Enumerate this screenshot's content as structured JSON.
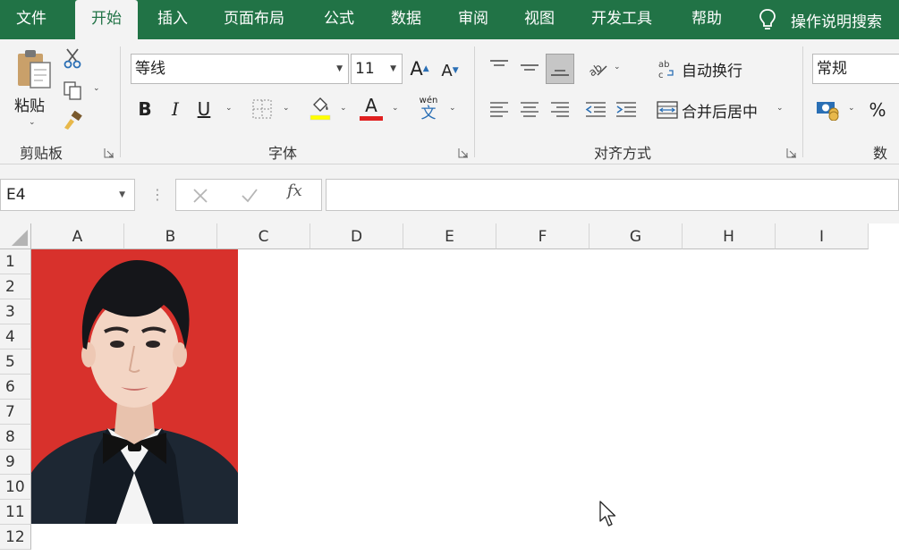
{
  "tabs": [
    {
      "label": "文件"
    },
    {
      "label": "开始"
    },
    {
      "label": "插入"
    },
    {
      "label": "页面布局"
    },
    {
      "label": "公式"
    },
    {
      "label": "数据"
    },
    {
      "label": "审阅"
    },
    {
      "label": "视图"
    },
    {
      "label": "开发工具"
    },
    {
      "label": "帮助"
    }
  ],
  "tell_me": "操作说明搜索",
  "ribbon": {
    "clipboard": {
      "paste_label": "粘贴",
      "group_label": "剪贴板"
    },
    "font": {
      "font_name": "等线",
      "font_size": "11",
      "grow_label": "A",
      "shrink_label": "A",
      "bold_label": "B",
      "italic_label": "I",
      "underline_label": "U",
      "font_color_label": "A",
      "phonetic_top": "wén",
      "phonetic_bottom": "文",
      "group_label": "字体",
      "accent_color": "#e02020"
    },
    "alignment": {
      "wrap_label": "自动换行",
      "merge_label": "合并后居中",
      "group_label": "对齐方式"
    },
    "number": {
      "format": "常规",
      "percent_label": "%",
      "group_label": "数字"
    }
  },
  "formula_bar": {
    "name_box": "E4",
    "fx_label": "fx",
    "formula": ""
  },
  "grid": {
    "columns": [
      "A",
      "B",
      "C",
      "D",
      "E",
      "F",
      "G",
      "H",
      "I"
    ],
    "rows": [
      "1",
      "2",
      "3",
      "4",
      "5",
      "6",
      "7",
      "8",
      "9",
      "10",
      "11",
      "12"
    ]
  },
  "colors": {
    "brand": "#217346",
    "photo_background": "#d8312c"
  }
}
